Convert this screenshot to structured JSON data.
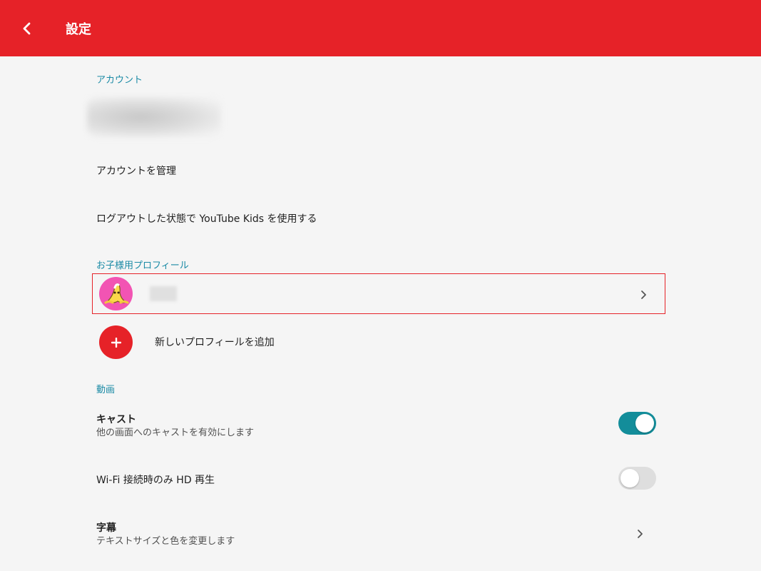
{
  "appbar": {
    "title": "設定",
    "back_icon": "chevron-left-icon"
  },
  "sections": {
    "account": {
      "header": "アカウント",
      "manage_label": "アカウントを管理",
      "signed_out_label": "ログアウトした状態で YouTube Kids を使用する"
    },
    "profiles": {
      "header": "お子様用プロフィール",
      "add_label": "新しいプロフィールを追加"
    },
    "video": {
      "header": "動画",
      "cast": {
        "title": "キャスト",
        "subtitle": "他の画面へのキャストを有効にします",
        "enabled": true
      },
      "wifi_hd": {
        "title": "Wi-Fi 接続時のみ HD 再生",
        "enabled": false
      },
      "captions": {
        "title": "字幕",
        "subtitle": "テキストサイズと色を変更します"
      }
    }
  },
  "colors": {
    "brand": "#e62228",
    "section_header": "#1a8aa5",
    "toggle_on": "#138d9a",
    "toggle_off": "#dedede",
    "avatar_bg": "#f254b3"
  }
}
